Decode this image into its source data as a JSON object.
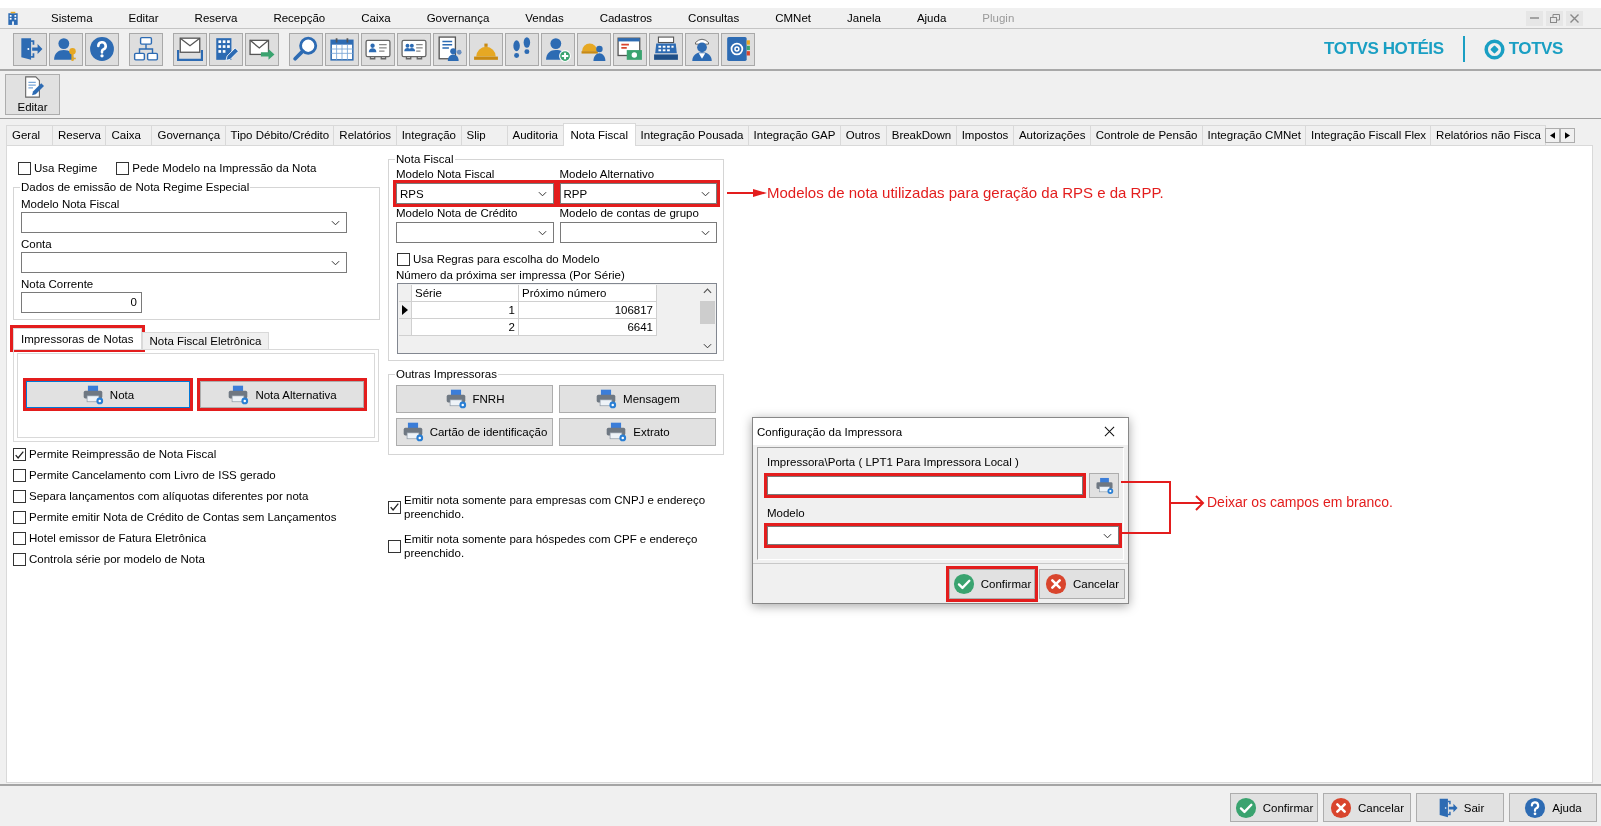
{
  "menu": {
    "items": [
      {
        "label": "Sistema",
        "disabled": false
      },
      {
        "label": "Editar",
        "disabled": false
      },
      {
        "label": "Reserva",
        "disabled": false
      },
      {
        "label": "Recepção",
        "disabled": false
      },
      {
        "label": "Caixa",
        "disabled": false
      },
      {
        "label": "Governança",
        "disabled": false
      },
      {
        "label": "Vendas",
        "disabled": false
      },
      {
        "label": "Cadastros",
        "disabled": false
      },
      {
        "label": "Consultas",
        "disabled": false
      },
      {
        "label": "CMNet",
        "disabled": false
      },
      {
        "label": "Janela",
        "disabled": false
      },
      {
        "label": "Ajuda",
        "disabled": false
      },
      {
        "label": "Plugin",
        "disabled": true
      }
    ]
  },
  "brand": {
    "product": "TOTVS HOTÉIS",
    "company": "TOTVS"
  },
  "action_bar": {
    "buttons": [
      {
        "label": "Editar"
      }
    ]
  },
  "tabs": [
    {
      "label": "Geral",
      "selected": false
    },
    {
      "label": "Reserva",
      "selected": false
    },
    {
      "label": "Caixa",
      "selected": false
    },
    {
      "label": "Governança",
      "selected": false
    },
    {
      "label": "Tipo Débito/Crédito",
      "selected": false
    },
    {
      "label": "Relatórios",
      "selected": false
    },
    {
      "label": "Integração",
      "selected": false
    },
    {
      "label": "Slip",
      "selected": false
    },
    {
      "label": "Auditoria",
      "selected": false
    },
    {
      "label": "Nota Fiscal",
      "selected": true
    },
    {
      "label": "Integração Pousada",
      "selected": false
    },
    {
      "label": "Integração GAP",
      "selected": false
    },
    {
      "label": "Outros",
      "selected": false
    },
    {
      "label": "BreakDown",
      "selected": false
    },
    {
      "label": "Impostos",
      "selected": false
    },
    {
      "label": "Autorizações",
      "selected": false
    },
    {
      "label": "Controle de Pensão",
      "selected": false
    },
    {
      "label": "Integração CMNet",
      "selected": false
    },
    {
      "label": "Integração Fiscall Flex",
      "selected": false
    },
    {
      "label": "Relatórios não Fisca",
      "selected": false
    }
  ],
  "regime": {
    "checkboxes": [
      {
        "label": "Usa Regime",
        "checked": false
      },
      {
        "label": "Pede Modelo na Impressão da Nota",
        "checked": false
      }
    ],
    "group": {
      "title": "Dados de emissão de Nota Regime Especial",
      "fields": [
        {
          "label": "Modelo Nota Fiscal",
          "kind": "combo"
        },
        {
          "label": "Conta",
          "kind": "combo"
        },
        {
          "label": "Nota Corrente",
          "kind": "number",
          "value": "0"
        }
      ]
    }
  },
  "printer_tabs": {
    "tabs": [
      {
        "label": "Impressoras de Notas",
        "selected": true,
        "highlighted": true
      },
      {
        "label": "Nota Fiscal Eletrônica",
        "selected": false,
        "highlighted": false
      }
    ],
    "buttons": [
      {
        "label": "Nota",
        "focused": true,
        "highlighted": true
      },
      {
        "label": "Nota Alternativa",
        "focused": false,
        "highlighted": true
      }
    ]
  },
  "options": [
    {
      "label": "Permite Reimpressão de Nota Fiscal",
      "checked": true
    },
    {
      "label": "Permite Cancelamento com Livro de ISS gerado",
      "checked": false
    },
    {
      "label": "Separa lançamentos com alíquotas diferentes por nota",
      "checked": false
    },
    {
      "label": "Permite emitir Nota de Crédito de Contas sem Lançamentos",
      "checked": false
    },
    {
      "label": "Hotel emissor de Fatura Eletrônica",
      "checked": false
    },
    {
      "label": "Controla série por modelo de Nota",
      "checked": false
    }
  ],
  "nota_fiscal": {
    "title": "Nota Fiscal",
    "fields": [
      {
        "label": "Modelo Nota Fiscal",
        "value": "RPS",
        "highlighted": true
      },
      {
        "label": "Modelo Alternativo",
        "value": "RPP",
        "highlighted": true
      },
      {
        "label": "Modelo Nota de Crédito",
        "highlighted": false
      },
      {
        "label": "Modelo de contas de grupo",
        "highlighted": false
      }
    ],
    "rules": {
      "label": "Usa Regras para escolha do Modelo",
      "checked": false
    },
    "series": {
      "title": "Número da próxima ser impressa (Por Série)",
      "columns": [
        "Série",
        "Próximo número"
      ],
      "rows": [
        {
          "cells": [
            "1",
            "106817"
          ],
          "selected": true
        },
        {
          "cells": [
            "2",
            "6641"
          ],
          "selected": false
        }
      ]
    }
  },
  "other_printers": {
    "title": "Outras Impressoras",
    "buttons": [
      {
        "label": "FNRH"
      },
      {
        "label": "Mensagem"
      },
      {
        "label": "Cartão de identificação"
      },
      {
        "label": "Extrato"
      }
    ]
  },
  "emit_options": [
    {
      "label": "Emitir nota somente para empresas com CNPJ e endereço preenchido.",
      "checked": true
    },
    {
      "label": "Emitir nota somente para hóspedes com CPF e endereço preenchido.",
      "checked": false
    }
  ],
  "dialog": {
    "title": "Configuração da Impressora",
    "fields": [
      {
        "label": "Impressora\\Porta ( LPT1 Para Impressora Local )",
        "kind": "text",
        "highlighted": true
      },
      {
        "label": "Modelo",
        "kind": "combo",
        "highlighted": true
      }
    ],
    "buttons": [
      {
        "label": "Confirmar",
        "kind": "confirm",
        "highlighted": true
      },
      {
        "label": "Cancelar",
        "kind": "cancel",
        "highlighted": false
      }
    ]
  },
  "annotations": [
    {
      "text": "Modelos de nota utilizadas para geração da RPS e da RPP."
    },
    {
      "text": "Deixar os campos em branco."
    }
  ],
  "footer": {
    "buttons": [
      {
        "label": "Confirmar",
        "kind": "confirm"
      },
      {
        "label": "Cancelar",
        "kind": "cancel"
      },
      {
        "label": "Sair",
        "kind": "exit"
      },
      {
        "label": "Ajuda",
        "kind": "help"
      }
    ]
  }
}
